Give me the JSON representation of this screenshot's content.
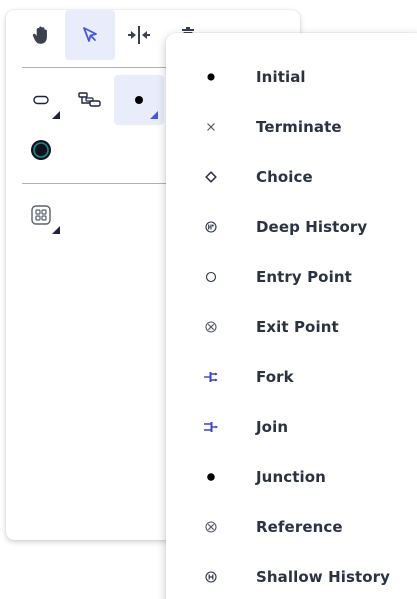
{
  "toolbar": {
    "tools": [
      {
        "name": "pan-tool",
        "icon": "hand-icon"
      },
      {
        "name": "select-tool",
        "icon": "cursor-icon",
        "selected": true
      },
      {
        "name": "distribute-tool",
        "icon": "split-arrows-icon"
      },
      {
        "name": "delete-tool",
        "icon": "trash-icon"
      }
    ],
    "palette": [
      {
        "name": "state-tool",
        "icon": "rounded-rect-icon"
      },
      {
        "name": "region-tool",
        "icon": "region-icon"
      },
      {
        "name": "pseudostate-tool",
        "icon": "filled-dot-icon",
        "selected": true
      },
      {
        "name": "final-state-tool",
        "icon": "final-state-icon"
      },
      {
        "name": "submachine-tool",
        "icon": "grid-box-icon"
      }
    ]
  },
  "menu": {
    "items": [
      {
        "label": "Initial",
        "icon": "filled-dot-icon"
      },
      {
        "label": "Terminate",
        "icon": "x-mark-icon"
      },
      {
        "label": "Choice",
        "icon": "diamond-icon"
      },
      {
        "label": "Deep History",
        "icon": "deep-history-icon"
      },
      {
        "label": "Entry Point",
        "icon": "hollow-circle-icon"
      },
      {
        "label": "Exit Point",
        "icon": "circle-x-icon"
      },
      {
        "label": "Fork",
        "icon": "fork-icon"
      },
      {
        "label": "Join",
        "icon": "join-icon"
      },
      {
        "label": "Junction",
        "icon": "filled-dot-icon"
      },
      {
        "label": "Reference",
        "icon": "circle-x-icon"
      },
      {
        "label": "Shallow History",
        "icon": "shallow-history-icon"
      }
    ]
  },
  "colors": {
    "accent": "#4659d6",
    "selected_bg": "#e8ecfb",
    "text": "#2b3242",
    "icon_dark": "#1f2340",
    "final_state_ring": "#1f8a86",
    "divider": "#aab3bd"
  }
}
